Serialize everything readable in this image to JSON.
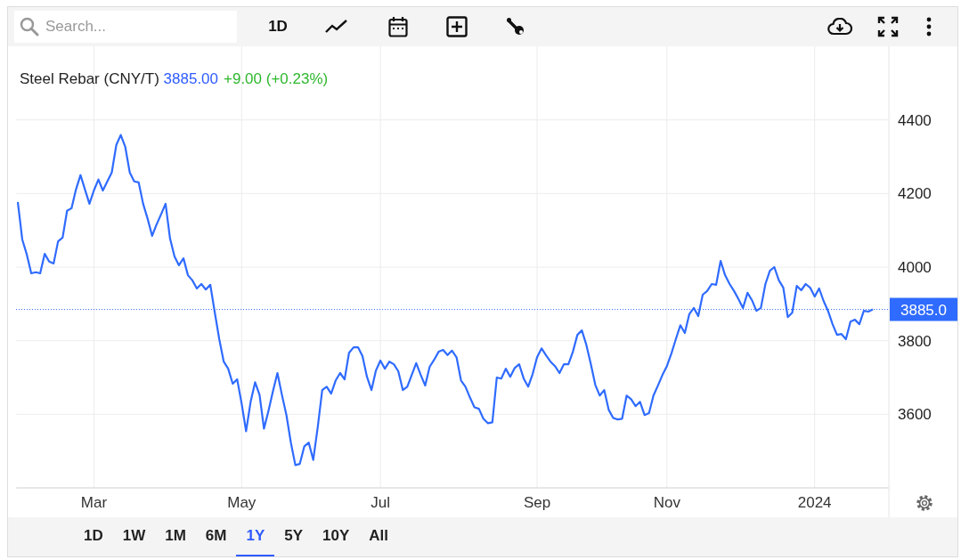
{
  "toolbar": {
    "search": {
      "placeholder": "Search..."
    },
    "interval": "1D"
  },
  "legend": {
    "price": "3885.00",
    "change": "+9.00 (+0.23%)"
  },
  "price_label": "3885.0",
  "chart_data": {
    "type": "line",
    "grid": true,
    "ref_lines": [
      {
        "axis": "y",
        "value": 3885
      }
    ],
    "ylim": [
      3400,
      4600
    ],
    "categories": [
      null,
      null,
      null,
      null,
      null,
      null,
      null,
      null,
      null,
      null,
      null,
      null,
      null,
      null,
      null,
      null,
      null,
      "Mar",
      null,
      null,
      null,
      null,
      null,
      null,
      null,
      null,
      null,
      null,
      null,
      null,
      null,
      null,
      null,
      null,
      null,
      null,
      null,
      null,
      null,
      null,
      null,
      null,
      null,
      null,
      null,
      null,
      null,
      null,
      null,
      null,
      "May",
      null,
      null,
      null,
      null,
      null,
      null,
      null,
      null,
      null,
      null,
      null,
      null,
      null,
      null,
      null,
      null,
      null,
      null,
      null,
      null,
      null,
      null,
      null,
      null,
      null,
      null,
      null,
      null,
      null,
      null,
      "Jul",
      null,
      null,
      null,
      null,
      null,
      null,
      null,
      null,
      null,
      null,
      null,
      null,
      null,
      null,
      null,
      null,
      null,
      null,
      null,
      null,
      null,
      null,
      null,
      null,
      null,
      null,
      null,
      null,
      null,
      null,
      null,
      null,
      null,
      null,
      "Sep",
      null,
      null,
      null,
      null,
      null,
      null,
      null,
      null,
      null,
      null,
      null,
      null,
      null,
      null,
      null,
      null,
      null,
      null,
      null,
      null,
      null,
      null,
      null,
      null,
      null,
      null,
      null,
      null,
      "Nov",
      null,
      null,
      null,
      null,
      null,
      null,
      null,
      null,
      null,
      null,
      null,
      null,
      null,
      null,
      null,
      null,
      null,
      null,
      null,
      null,
      null,
      null,
      null,
      null,
      null,
      null,
      null,
      null,
      null,
      null,
      null,
      null,
      "2024",
      null,
      null,
      null,
      null,
      null,
      null,
      null,
      null,
      null,
      null,
      null,
      null,
      null
    ],
    "yticks": [
      3600,
      3800,
      4000,
      4200,
      4400
    ],
    "series": [
      {
        "name": "Steel Rebar (CNY/T)",
        "color": "#2f6bff",
        "values": [
          4177,
          4075,
          4034,
          3983,
          3986,
          3983,
          4036,
          4015,
          4010,
          4070,
          4080,
          4153,
          4160,
          4211,
          4250,
          4211,
          4172,
          4208,
          4238,
          4208,
          4233,
          4257,
          4332,
          4359,
          4327,
          4257,
          4233,
          4230,
          4172,
          4131,
          4085,
          4116,
          4143,
          4172,
          4078,
          4029,
          4005,
          4024,
          3978,
          3964,
          3942,
          3954,
          3939,
          3952,
          3876,
          3804,
          3743,
          3724,
          3683,
          3695,
          3629,
          3554,
          3634,
          3687,
          3653,
          3561,
          3610,
          3663,
          3712,
          3653,
          3598,
          3523,
          3462,
          3465,
          3513,
          3523,
          3476,
          3566,
          3666,
          3675,
          3656,
          3692,
          3712,
          3695,
          3767,
          3782,
          3782,
          3758,
          3702,
          3666,
          3719,
          3746,
          3724,
          3743,
          3736,
          3717,
          3666,
          3675,
          3707,
          3739,
          3707,
          3678,
          3729,
          3748,
          3770,
          3775,
          3761,
          3773,
          3755,
          3692,
          3675,
          3646,
          3619,
          3615,
          3588,
          3576,
          3578,
          3700,
          3697,
          3724,
          3702,
          3726,
          3736,
          3697,
          3675,
          3709,
          3755,
          3779,
          3760,
          3743,
          3731,
          3712,
          3736,
          3736,
          3770,
          3816,
          3828,
          3789,
          3736,
          3680,
          3651,
          3666,
          3612,
          3590,
          3586,
          3588,
          3651,
          3641,
          3622,
          3634,
          3598,
          3603,
          3651,
          3678,
          3707,
          3731,
          3765,
          3804,
          3842,
          3821,
          3872,
          3889,
          3867,
          3925,
          3935,
          3954,
          3952,
          4017,
          3978,
          3954,
          3935,
          3913,
          3889,
          3930,
          3910,
          3881,
          3889,
          3954,
          3990,
          4000,
          3964,
          3944,
          3864,
          3876,
          3949,
          3937,
          3954,
          3944,
          3920,
          3942,
          3908,
          3881,
          3845,
          3816,
          3818,
          3804,
          3852,
          3857,
          3845,
          3881,
          3879,
          3885
        ]
      }
    ]
  },
  "ranges": [
    {
      "label": "1D",
      "selected": false
    },
    {
      "label": "1W",
      "selected": false
    },
    {
      "label": "1M",
      "selected": false
    },
    {
      "label": "6M",
      "selected": false
    },
    {
      "label": "1Y",
      "selected": true
    },
    {
      "label": "5Y",
      "selected": false
    },
    {
      "label": "10Y",
      "selected": false
    },
    {
      "label": "All",
      "selected": false
    }
  ]
}
